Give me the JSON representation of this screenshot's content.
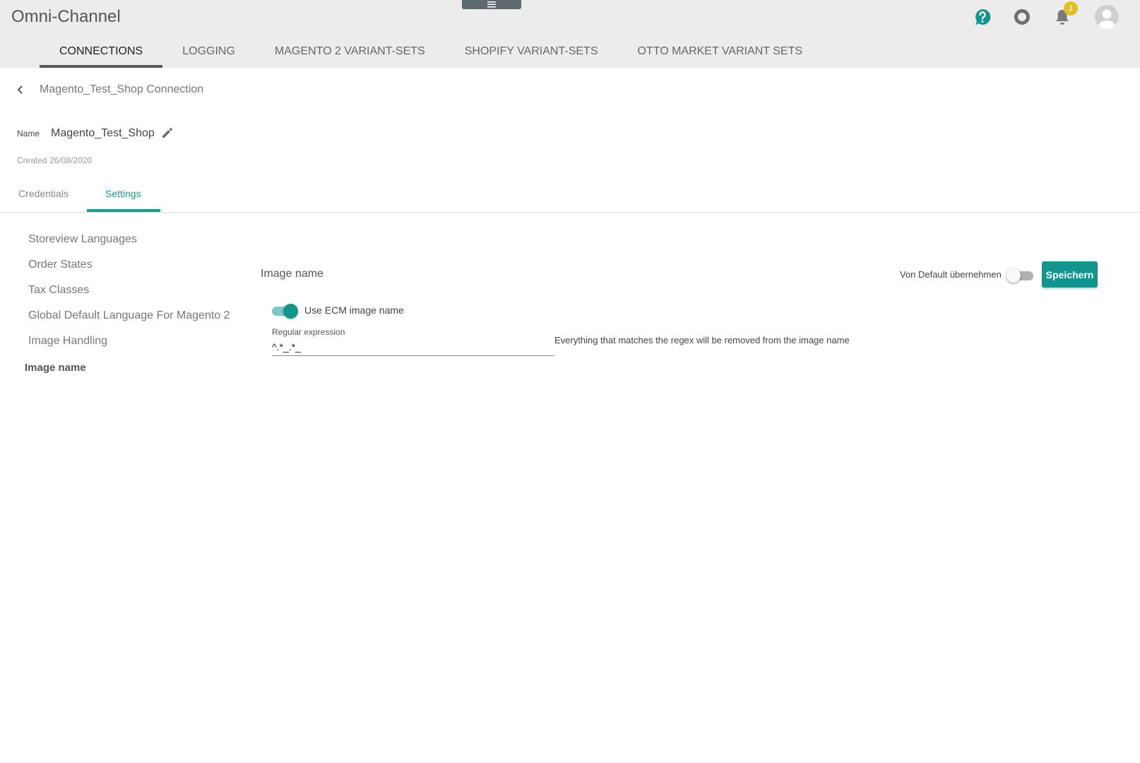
{
  "header": {
    "app_title": "Omni-Channel",
    "notification_count": "1",
    "nav_tabs": [
      {
        "label": "CONNECTIONS",
        "active": true
      },
      {
        "label": "LOGGING",
        "active": false
      },
      {
        "label": "MAGENTO 2 VARIANT-SETS",
        "active": false
      },
      {
        "label": "SHOPIFY VARIANT-SETS",
        "active": false
      },
      {
        "label": "OTTO MARKET VARIANT SETS",
        "active": false
      }
    ],
    "icons": [
      "help-icon",
      "ring-icon",
      "bell-icon",
      "avatar-icon"
    ],
    "accent_color": "#11968f"
  },
  "connection": {
    "back_title": "Magento_Test_Shop Connection",
    "name_label": "Name",
    "name_value": "Magento_Test_Shop",
    "created": "Created 26/08/2020"
  },
  "sub_tabs": [
    {
      "label": "Credentials",
      "active": false
    },
    {
      "label": "Settings",
      "active": true
    }
  ],
  "sidebar": {
    "items": [
      {
        "label": "Storeview Languages",
        "active": false
      },
      {
        "label": "Order States",
        "active": false
      },
      {
        "label": "Tax Classes",
        "active": false
      },
      {
        "label": "Global Default Language For Magento 2",
        "active": false
      },
      {
        "label": "Image Handling",
        "active": false
      },
      {
        "label": "Image name",
        "active": true
      }
    ]
  },
  "content": {
    "title": "Image name",
    "default_label": "Von Default übernehmen",
    "default_toggle_on": false,
    "save_label": "Speichern",
    "use_ecm_toggle_on": true,
    "use_ecm_label": "Use ECM image name",
    "regex_label": "Regular expression",
    "regex_value": "^.*_.*_",
    "regex_hint": "Everything that matches the regex will be removed from the image name"
  }
}
